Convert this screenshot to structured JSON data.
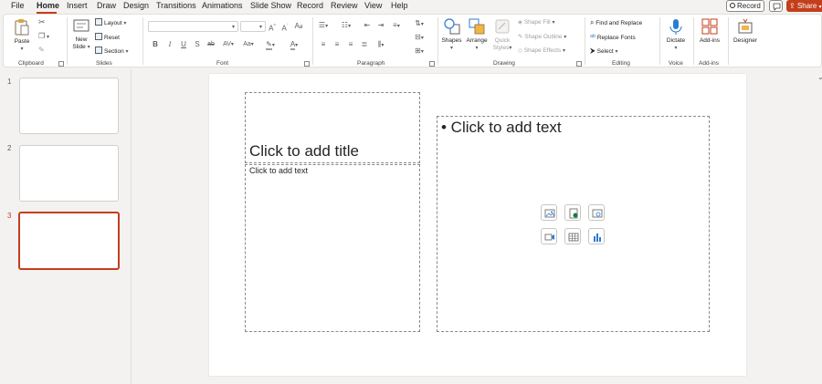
{
  "tabs": [
    "File",
    "Home",
    "Insert",
    "Draw",
    "Design",
    "Transitions",
    "Animations",
    "Slide Show",
    "Record",
    "Review",
    "View",
    "Help"
  ],
  "active_tab": "Home",
  "record_label": "Record",
  "share_label": "Share",
  "ribbon": {
    "clipboard": {
      "group_label": "Clipboard",
      "paste": "Paste"
    },
    "slides": {
      "group_label": "Slides",
      "new_slide_line1": "New",
      "new_slide_line2": "Slide",
      "layout": "Layout",
      "reset": "Reset",
      "section": "Section"
    },
    "font": {
      "group_label": "Font",
      "font_name": "",
      "font_size": ""
    },
    "paragraph": {
      "group_label": "Paragraph"
    },
    "drawing": {
      "group_label": "Drawing",
      "shapes": "Shapes",
      "arrange": "Arrange",
      "quick_styles_line1": "Quick",
      "quick_styles_line2": "Styles",
      "shape_fill": "Shape Fill",
      "shape_outline": "Shape Outline",
      "shape_effects": "Shape Effects"
    },
    "editing": {
      "group_label": "Editing",
      "find_replace": "Find and Replace",
      "replace_fonts": "Replace Fonts",
      "select": "Select"
    },
    "voice": {
      "group_label": "Voice",
      "dictate": "Dictate"
    },
    "addins": {
      "group_label": "Add-ins",
      "addins": "Add-ins"
    },
    "designer": {
      "designer": "Designer"
    }
  },
  "thumbnails": [
    {
      "number": "1",
      "selected": false
    },
    {
      "number": "2",
      "selected": false
    },
    {
      "number": "3",
      "selected": true
    }
  ],
  "slide": {
    "title_placeholder": "Click to add title",
    "text_placeholder": "Click to add text",
    "content_placeholder": "• Click to add text"
  },
  "colors": {
    "accent": "#c43e1c",
    "blue_icon": "#2b7cd3",
    "green_icon": "#107c41"
  }
}
